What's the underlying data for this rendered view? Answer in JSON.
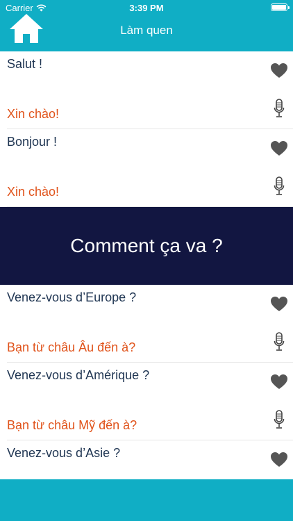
{
  "status": {
    "carrier": "Carrier",
    "time": "3:39 PM"
  },
  "header": {
    "title": "Làm quen"
  },
  "items": [
    {
      "fr": "Salut !",
      "vi": "Xin chào!"
    },
    {
      "fr": "Bonjour !",
      "vi": "Xin chào!"
    }
  ],
  "section": {
    "title": "Comment ça va ?"
  },
  "items2": [
    {
      "fr": "Venez-vous d’Europe ?",
      "vi": "Bạn từ châu Âu đến à?"
    },
    {
      "fr": "Venez-vous d’Amérique ?",
      "vi": "Bạn từ châu Mỹ đến à?"
    },
    {
      "fr": "Venez-vous d’Asie ?"
    }
  ],
  "colors": {
    "header": "#10aec5",
    "section": "#121641",
    "french": "#1f3552",
    "vietnamese": "#e0531b",
    "icon": "#555555"
  },
  "icons": [
    "wifi-icon",
    "battery-icon",
    "home-icon",
    "heart-icon",
    "microphone-icon"
  ]
}
